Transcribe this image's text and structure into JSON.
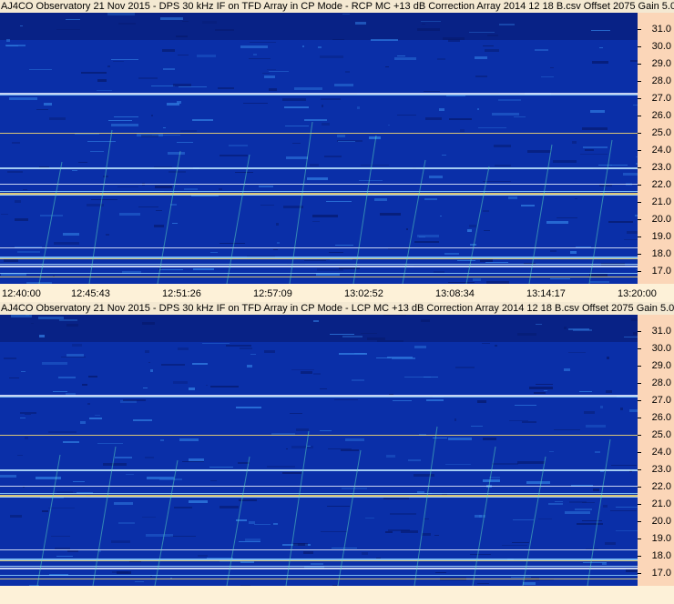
{
  "panels": [
    {
      "title": "AJ4CO Observatory 21 Nov 2015 - DPS 30 kHz IF on TFD Array in CP Mode - RCP  MC +13 dB  Correction Array 2014 12 18 B.csv  Offset 2075  Gain 5.0",
      "mode": "RCP"
    },
    {
      "title": "AJ4CO Observatory 21 Nov 2015 - DPS 30 kHz IF on TFD Array in CP Mode - LCP  MC +13 dB  Correction Array 2014 12 18 B.csv  Offset 2075  Gain 5.0",
      "mode": "LCP"
    }
  ],
  "frequency_ticks": [
    "31.0",
    "30.0",
    "29.0",
    "28.0",
    "27.0",
    "26.0",
    "25.0",
    "24.0",
    "23.0",
    "22.0",
    "21.0",
    "20.0",
    "19.0",
    "18.0",
    "17.0"
  ],
  "time_ticks": [
    "12:40:00",
    "12:45:43",
    "12:51:26",
    "12:57:09",
    "13:02:52",
    "13:08:34",
    "13:14:17",
    "13:20:00"
  ],
  "colors": {
    "background": "#0a2fa8",
    "dark": "#061a70",
    "light": "#2f7be0",
    "axis_bg": "#fbd6b8",
    "panel_bg": "#fdf1d8"
  }
}
